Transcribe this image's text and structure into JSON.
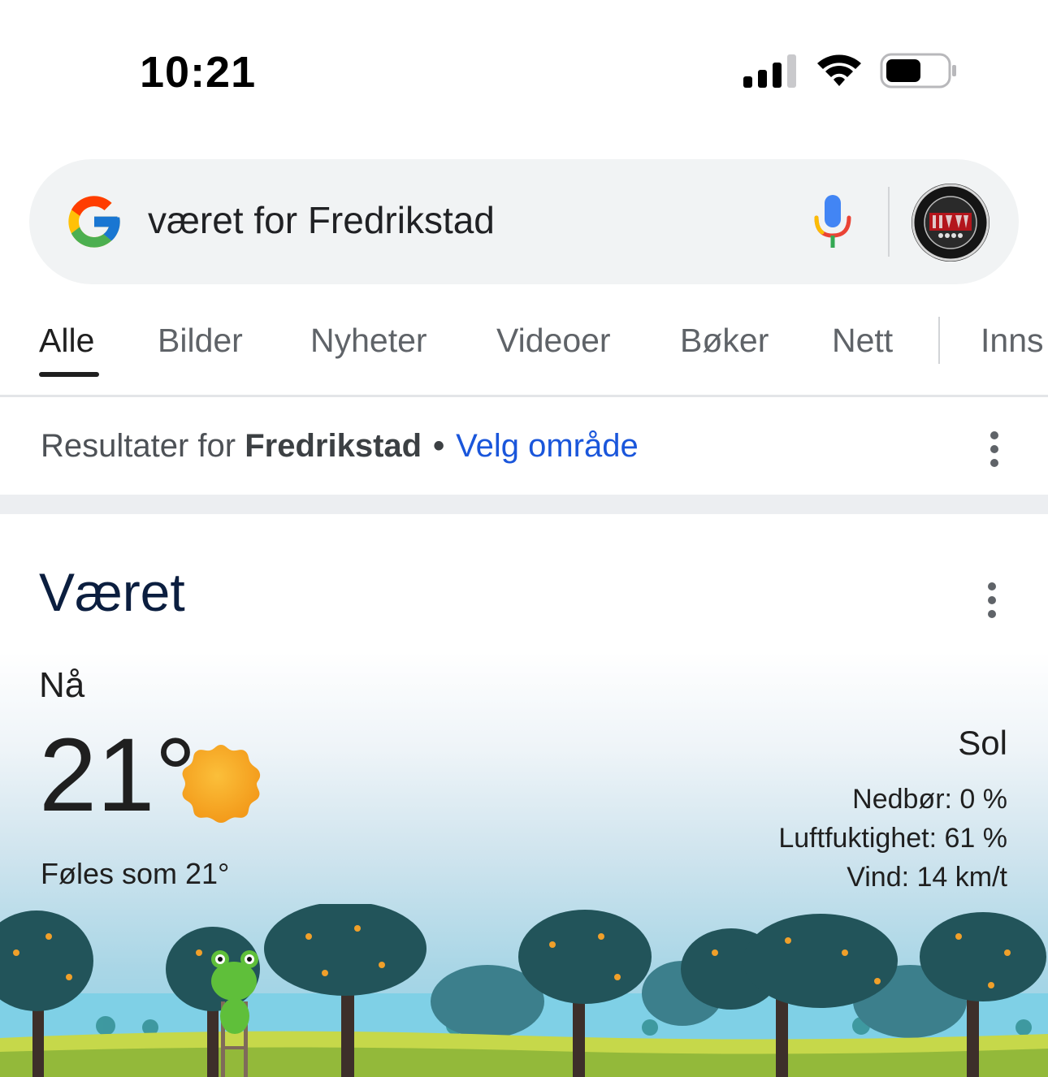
{
  "status_bar": {
    "time": "10:21"
  },
  "search": {
    "query": "været for Fredrikstad",
    "icons": [
      "google-logo",
      "mic-icon",
      "avatar"
    ]
  },
  "tabs": [
    {
      "label": "Alle",
      "active": true
    },
    {
      "label": "Bilder",
      "active": false
    },
    {
      "label": "Nyheter",
      "active": false
    },
    {
      "label": "Videoer",
      "active": false
    },
    {
      "label": "Bøker",
      "active": false
    },
    {
      "label": "Nett",
      "active": false
    },
    {
      "label": "Inns",
      "active": false
    }
  ],
  "results": {
    "prefix": "Resultater for",
    "location": "Fredrikstad",
    "separator": "•",
    "choose_area": "Velg område"
  },
  "weather": {
    "title": "Været",
    "now_label": "Nå",
    "temperature": "21°",
    "feels_like": "Føles som 21°",
    "condition": "Sol",
    "precipitation": "Nedbør: 0 %",
    "humidity": "Luftfuktighet: 61 %",
    "wind": "Vind: 14 km/t"
  },
  "colors": {
    "accent_link": "#1a56db",
    "title_navy": "#0b1e3f",
    "sun": "#f6a623"
  }
}
